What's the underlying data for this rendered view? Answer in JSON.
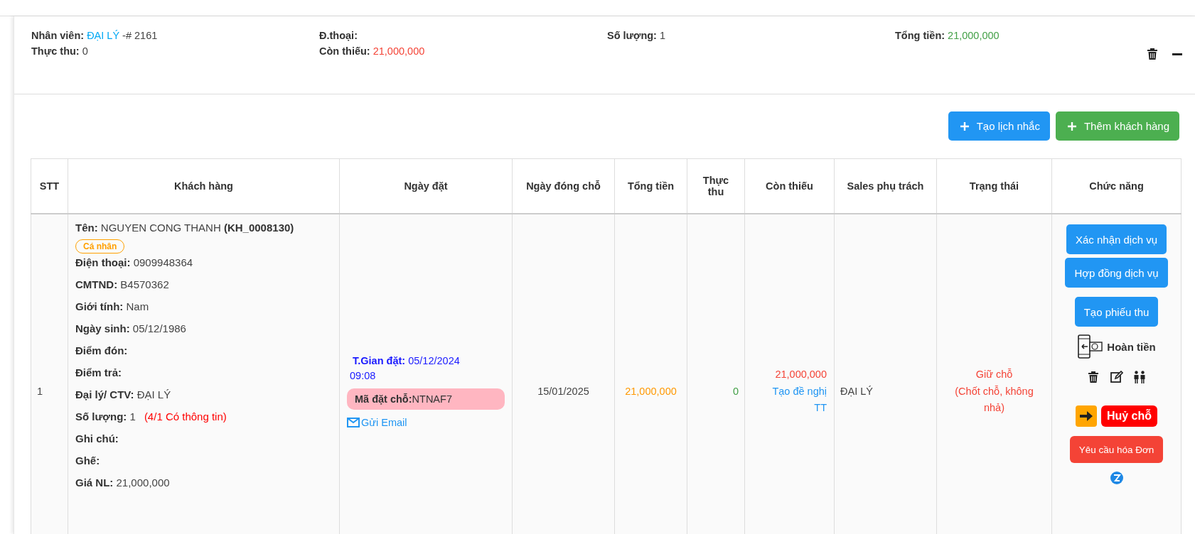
{
  "summary": {
    "items": [
      {
        "label": "Nhân viên:",
        "value": "ĐẠI LÝ",
        "color": "#03a9f4",
        "extra": "-# 2161"
      },
      {
        "label": "Đ.thoại:"
      },
      {
        "label": "Số lượng:",
        "value": "1",
        "color": "#444444"
      },
      {
        "label": "Tổng tiền:",
        "value": "21,000,000",
        "color": "#43a047"
      },
      {
        "label": "Thực thu:",
        "value": "0",
        "color": "#444444"
      },
      {
        "label": "Còn thiếu:",
        "value": "21,000,000",
        "color": "#f44336"
      }
    ]
  },
  "toolbar": [
    {
      "label": "Tạo lịch nhắc",
      "kind": "primary"
    },
    {
      "label": "Thêm khách hàng",
      "kind": "success"
    }
  ],
  "table": {
    "columns": [
      "STT",
      "Khách hàng",
      "Ngày đặt",
      "Ngày đóng chỗ",
      "Tổng tiền",
      "Thực thu",
      "Còn thiếu",
      "Sales phụ trách",
      "Trạng thái",
      "Chức năng"
    ],
    "rows": [
      {
        "stt": "1",
        "customer": {
          "name_label": "Tên:",
          "name": "NGUYEN CONG THANH",
          "code": "(KH_0008130)",
          "tag": "Cá nhân",
          "fields": [
            {
              "label": "Điện thoại:",
              "value": "0909948364"
            },
            {
              "label": "CMTND:",
              "value": "B4570362"
            },
            {
              "label": "Giới tính:",
              "value": "Nam"
            },
            {
              "label": "Ngày sinh:",
              "value": "05/12/1986"
            },
            {
              "label": "Điểm đón:"
            },
            {
              "label": "Điểm trả:"
            },
            {
              "label": "Đại lý/ CTV:",
              "value": "ĐẠI LÝ"
            },
            {
              "label": "Số lượng:",
              "value": "1",
              "note": "(4/1 Có thông tin)"
            },
            {
              "label": "Ghi chú:"
            },
            {
              "label": "Ghế:"
            },
            {
              "label": "Giá NL:",
              "value": "21,000,000"
            }
          ]
        },
        "booking": {
          "time_label": "T.Gian đặt:",
          "time": "05/12/2024 09:08",
          "code_label": "Mã đặt chỗ:",
          "code": "NTNAF7",
          "email": "Gửi Email"
        },
        "close_date": "15/01/2025",
        "total": "21,000,000",
        "paid": "0",
        "owed": "21,000,000",
        "owed_link": "Tạo đề nghị TT",
        "sales": "ĐẠI LÝ",
        "status": "Giữ chỗ",
        "status_note": "(Chốt chỗ, không nhả)",
        "actions": {
          "buttons": [
            "Xác nhận dịch vụ",
            "Hợp đồng dịch vụ",
            "Tạo phiếu thu"
          ],
          "refund": "Hoàn tiền",
          "cancel": "Huỷ chỗ",
          "invoice": "Yêu cầu hóa Đơn"
        }
      }
    ]
  }
}
